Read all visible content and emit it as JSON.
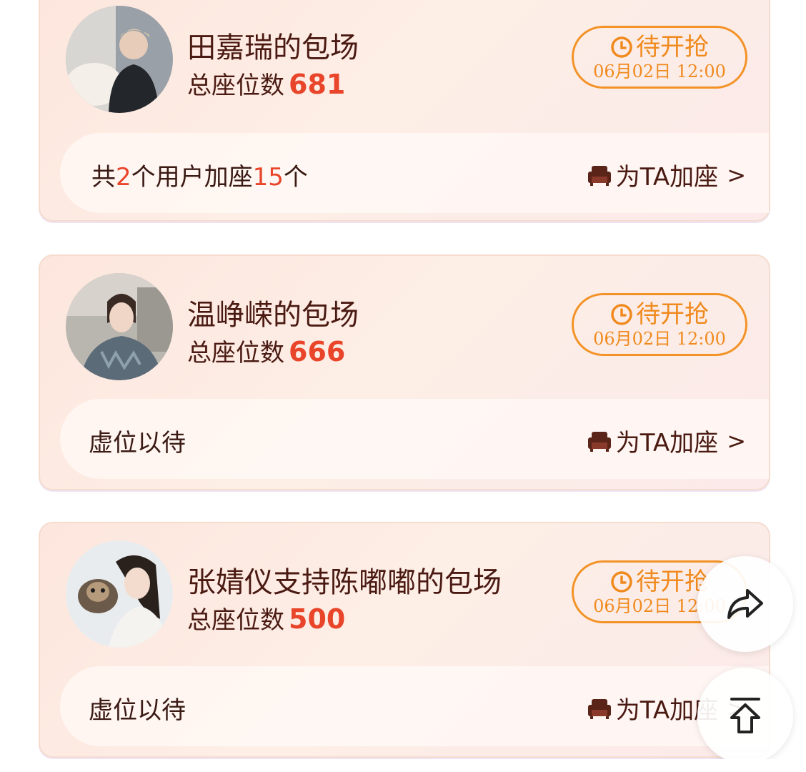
{
  "cards": [
    {
      "title": "田嘉瑞的包场",
      "seat_label": "总座位数",
      "seat_count": "681",
      "status": "待开抢",
      "time": "06月02日 12:00",
      "bottom_prefix": "共",
      "bottom_users": "2",
      "bottom_mid": "个用户加座",
      "bottom_seats": "15",
      "bottom_suffix": "个",
      "action": "为TA加座"
    },
    {
      "title": "温峥嵘的包场",
      "seat_label": "总座位数",
      "seat_count": "666",
      "status": "待开抢",
      "time": "06月02日 12:00",
      "bottom_text": "虚位以待",
      "action": "为TA加座"
    },
    {
      "title": "张婧仪支持陈嘟嘟的包场",
      "seat_label": "总座位数",
      "seat_count": "500",
      "status": "待开抢",
      "time": "06月02日 12:00",
      "bottom_text": "虚位以待",
      "action": "为TA加座"
    }
  ],
  "chevron": ">",
  "icons": {
    "status": "clock-icon",
    "action": "sofa-icon",
    "share": "share-icon",
    "top": "back-to-top-icon"
  },
  "colors": {
    "accent_orange": "#f08a1e",
    "highlight_red": "#e9452a",
    "text_brown": "#4a1a12"
  }
}
